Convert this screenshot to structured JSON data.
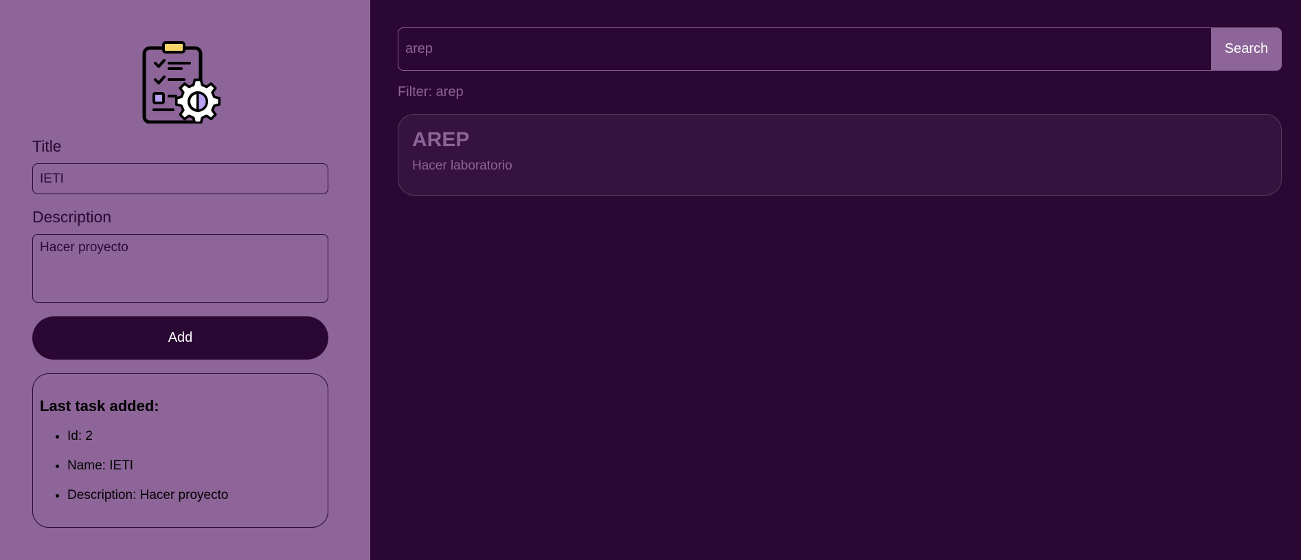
{
  "form": {
    "icon": "clipboard-gear-icon",
    "title_label": "Title",
    "title_value": "IETI",
    "description_label": "Description",
    "description_value": "Hacer proyecto",
    "add_label": "Add"
  },
  "last_task": {
    "heading": "Last task added:",
    "id": "Id: 2",
    "name": "Name: IETI",
    "description": "Description: Hacer proyecto"
  },
  "search": {
    "value": "arep",
    "button_label": "Search",
    "filter_text": "Filter: arep"
  },
  "tasks": [
    {
      "title": "AREP",
      "description": "Hacer laboratorio"
    }
  ],
  "colors": {
    "left_panel_bg": "#8d6598",
    "right_panel_bg": "#2b0833",
    "card_bg": "#36123e",
    "accent": "#8d6598"
  }
}
